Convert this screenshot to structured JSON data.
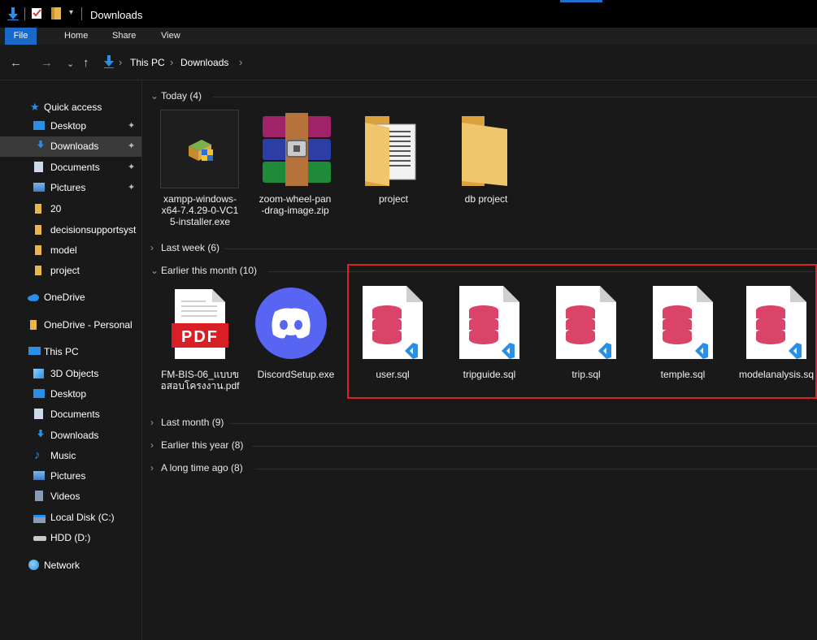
{
  "window": {
    "title": "Downloads"
  },
  "ribbon": {
    "tabs": [
      "File",
      "Home",
      "Share",
      "View"
    ]
  },
  "address": {
    "crumbs": [
      "This PC",
      "Downloads"
    ]
  },
  "sidebar": {
    "quick_access": "Quick access",
    "quick": [
      {
        "label": "Desktop",
        "pinned": true
      },
      {
        "label": "Downloads",
        "pinned": true,
        "selected": true
      },
      {
        "label": "Documents",
        "pinned": true
      },
      {
        "label": "Pictures",
        "pinned": true
      },
      {
        "label": "20"
      },
      {
        "label": "decisionsupportsyst"
      },
      {
        "label": "model"
      },
      {
        "label": "project"
      }
    ],
    "onedrive": "OneDrive",
    "onedrive_personal": "OneDrive - Personal",
    "this_pc": "This PC",
    "pc_items": [
      "3D Objects",
      "Desktop",
      "Documents",
      "Downloads",
      "Music",
      "Pictures",
      "Videos",
      "Local Disk (C:)",
      "HDD (D:)"
    ],
    "network": "Network"
  },
  "groups": {
    "today": "Today (4)",
    "last_week": "Last week (6)",
    "earlier_month": "Earlier this month (10)",
    "last_month": "Last month (9)",
    "earlier_year": "Earlier this year (8)",
    "long_ago": "A long time ago (8)"
  },
  "today_files": [
    {
      "line1": "xampp-windows-",
      "line2": "x64-7.4.29-0-VC1",
      "line3": "5-installer.exe"
    },
    {
      "line1": "zoom-wheel-pan",
      "line2": "-drag-image.zip",
      "line3": ""
    },
    {
      "line1": "project",
      "line2": "",
      "line3": ""
    },
    {
      "line1": "db project",
      "line2": "",
      "line3": ""
    }
  ],
  "month_files": [
    {
      "line1": "FM-BIS-06_แบบข",
      "line2": "อสอบโครงงาน.pdf"
    },
    {
      "line1": "DiscordSetup.exe",
      "line2": ""
    },
    {
      "line1": "user.sql",
      "line2": ""
    },
    {
      "line1": "tripguide.sql",
      "line2": ""
    },
    {
      "line1": "trip.sql",
      "line2": ""
    },
    {
      "line1": "temple.sql",
      "line2": ""
    },
    {
      "line1": "modelanalysis.sq",
      "line2": ""
    }
  ],
  "icons": {
    "pdf_label": "PDF"
  },
  "colors": {
    "accent": "#1a69c9",
    "folder": "#e8b64a",
    "sql_db": "#d94468",
    "vscode": "#2a8fe6",
    "discord": "#5865f2",
    "pdf_red": "#d81f26",
    "highlight": "#e0212d"
  }
}
